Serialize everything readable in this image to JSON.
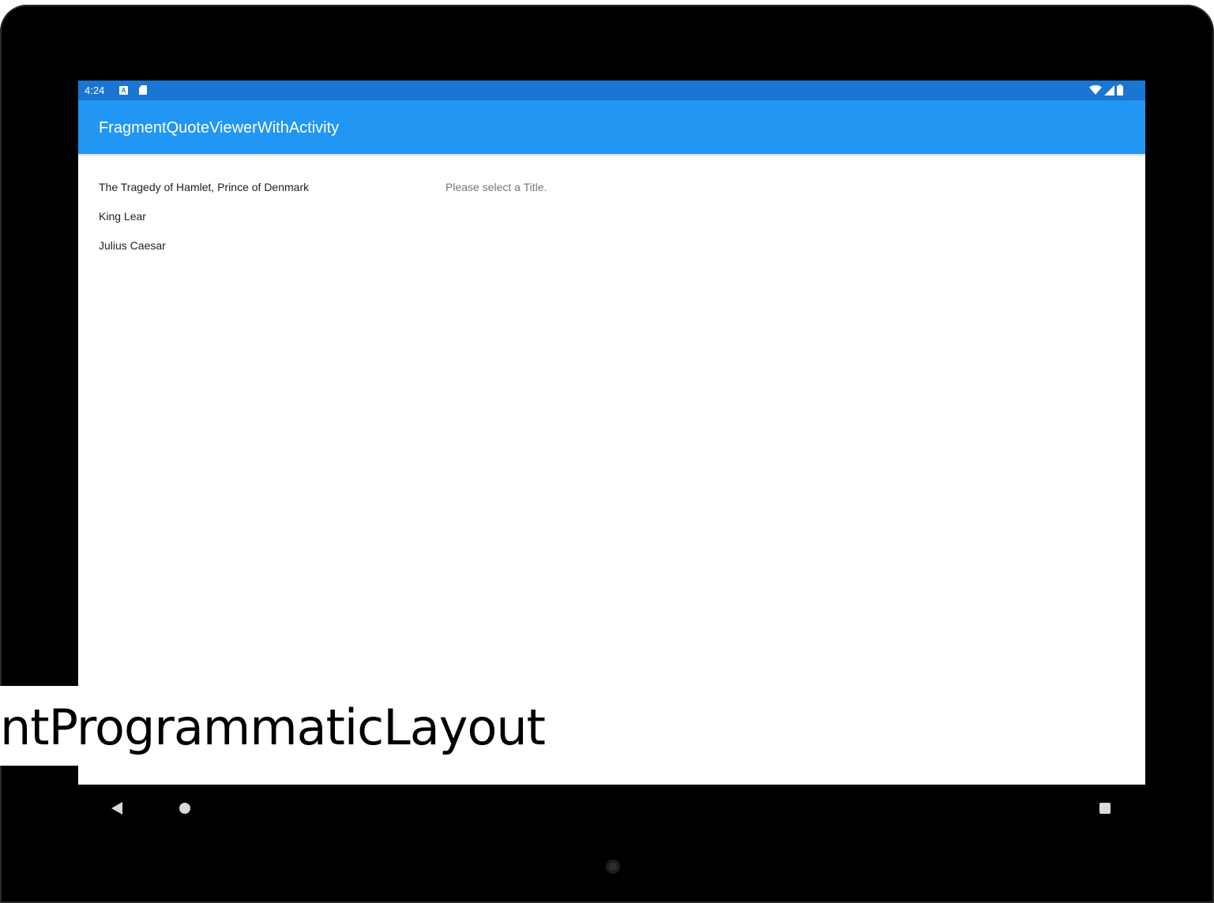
{
  "status_bar": {
    "time": "4:24",
    "notification_icon_a_label": "A",
    "icons": [
      "a-notification-icon",
      "sd-card-icon",
      "wifi-icon",
      "signal-icon",
      "battery-icon"
    ]
  },
  "app_bar": {
    "title": "FragmentQuoteViewerWithActivity"
  },
  "titles": [
    "The Tragedy of Hamlet, Prince of Denmark",
    "King Lear",
    "Julius Caesar"
  ],
  "detail": {
    "placeholder": "Please select a Title."
  },
  "navigation": {
    "icons": [
      "back-icon",
      "home-icon",
      "recents-icon"
    ]
  },
  "caption": {
    "text": "FragmentProgrammaticLayout"
  },
  "colors": {
    "status_bar": "#1976d2",
    "app_bar": "#2196f3",
    "frame": "#000000"
  }
}
